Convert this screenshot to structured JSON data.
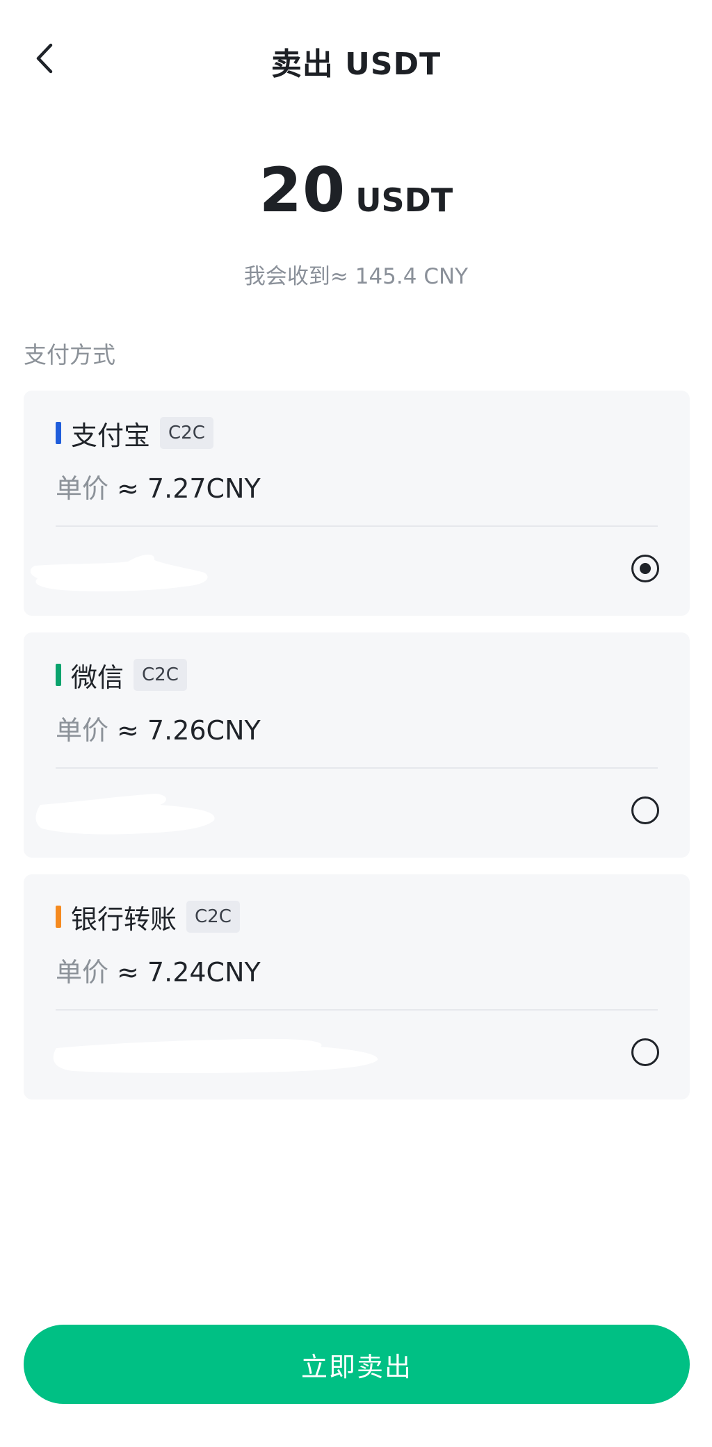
{
  "header": {
    "title": "卖出  USDT",
    "back_icon": "chevron-left-icon"
  },
  "amount": {
    "value": "20",
    "unit": "USDT",
    "receive_text": "我会收到≈ 145.4 CNY"
  },
  "payment_section": {
    "label": "支付方式",
    "methods": [
      {
        "name": "支付宝",
        "tag": "C2C",
        "price_label": "单价",
        "price_value": "≈ 7.27CNY",
        "accent_color": "#1f5ddb",
        "selected": true
      },
      {
        "name": "微信",
        "tag": "C2C",
        "price_label": "单价",
        "price_value": "≈ 7.26CNY",
        "accent_color": "#0aa36d",
        "selected": false
      },
      {
        "name": "银行转账",
        "tag": "C2C",
        "price_label": "单价",
        "price_value": "≈ 7.24CNY",
        "accent_color": "#f58a1f",
        "selected": false
      }
    ]
  },
  "action": {
    "sell_label": "立即卖出",
    "button_color": "#00c084"
  }
}
